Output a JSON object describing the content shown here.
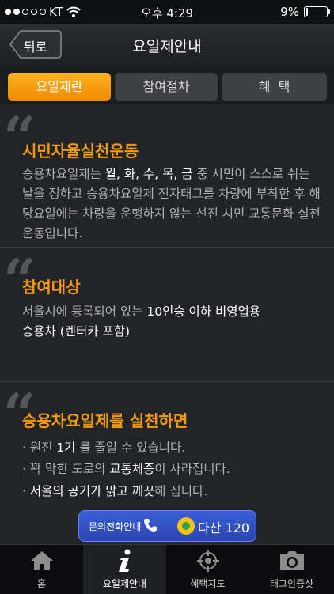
{
  "status": {
    "carrier": "KT",
    "time": "오후 4:29",
    "battery": "9%"
  },
  "nav": {
    "back": "뒤로",
    "title": "요일제안내"
  },
  "tabs": [
    "요일제란",
    "참여절차",
    "혜  택"
  ],
  "sections": {
    "s1": {
      "title": "시민자율실천운동"
    },
    "s2": {
      "title": "참여대상",
      "line1a": "서울시에 등록되어 있는 ",
      "line1b": "10인승 이하 비영업용",
      "line2": "승용차 (렌터카 포함)"
    },
    "s3": {
      "title": "승용차요일제를 실천하면",
      "b1a": "· 원전 ",
      "b1b": "1기",
      "b1c": " 를 줄일 수 있습니다.",
      "b2a": "· 꽉 막힌 도로의 ",
      "b2b": "교통체증",
      "b2c": "이 사라집니다.",
      "b3a": "· ",
      "b3b": "서울의 공기가 맑고 깨끗",
      "b3c": "해 집니다."
    }
  },
  "call": {
    "label": "문의전화안내",
    "number": "다산 120"
  },
  "tabbar": [
    "홈",
    "요일제안내",
    "혜택지도",
    "태그인증샷"
  ]
}
